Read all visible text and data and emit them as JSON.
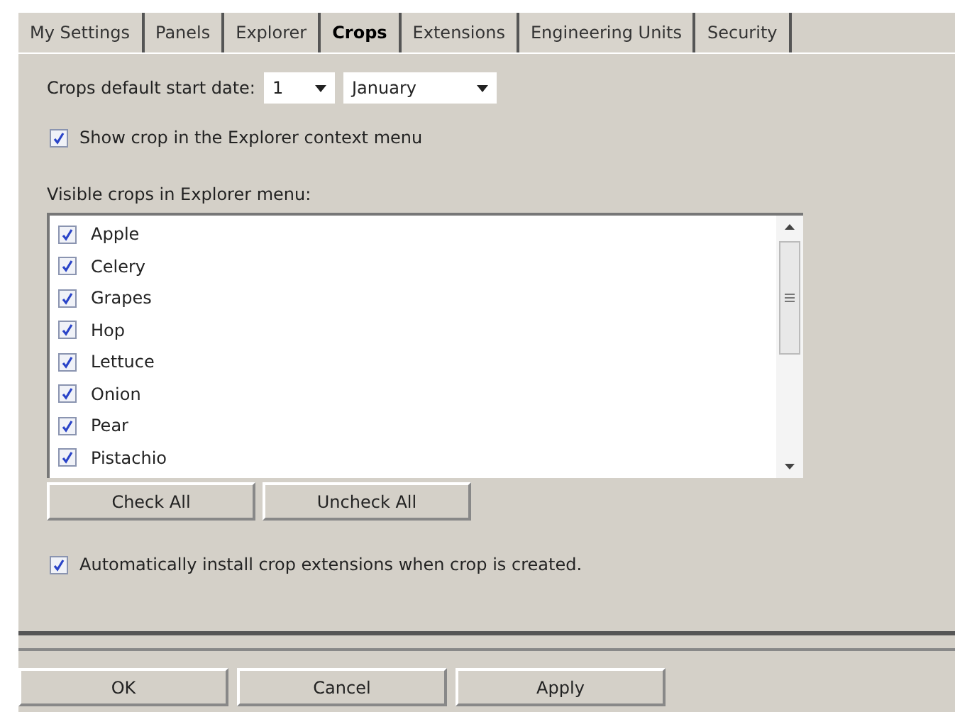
{
  "tabs": [
    {
      "label": "My Settings",
      "selected": false
    },
    {
      "label": "Panels",
      "selected": false
    },
    {
      "label": "Explorer",
      "selected": false
    },
    {
      "label": "Crops",
      "selected": true
    },
    {
      "label": "Extensions",
      "selected": false
    },
    {
      "label": "Engineering Units",
      "selected": false
    },
    {
      "label": "Security",
      "selected": false
    }
  ],
  "start_date": {
    "label": "Crops default start date:",
    "day": "1",
    "month": "January"
  },
  "show_in_context_menu": {
    "label": "Show crop in the Explorer context menu",
    "checked": true
  },
  "visible_crops": {
    "label": "Visible crops in Explorer menu:",
    "items": [
      {
        "label": "Apple",
        "checked": true
      },
      {
        "label": "Celery",
        "checked": true
      },
      {
        "label": "Grapes",
        "checked": true
      },
      {
        "label": "Hop",
        "checked": true
      },
      {
        "label": "Lettuce",
        "checked": true
      },
      {
        "label": "Onion",
        "checked": true
      },
      {
        "label": "Pear",
        "checked": true
      },
      {
        "label": "Pistachio",
        "checked": true
      }
    ]
  },
  "list_buttons": [
    "Check All",
    "Uncheck All"
  ],
  "auto_install": {
    "label": "Automatically install crop extensions when crop is created.",
    "checked": true
  },
  "dialog_buttons": [
    "OK",
    "Cancel",
    "Apply"
  ]
}
